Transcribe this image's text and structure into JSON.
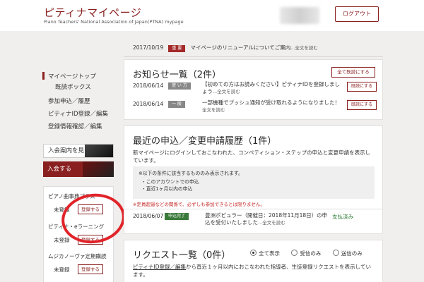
{
  "header": {
    "title": "ピティナマイページ",
    "subtitle": "Piano Teachers' National Association of Japan(PTNA) mypage",
    "logout": "ログアウト"
  },
  "sidebar": {
    "items": [
      {
        "label": "マイページトップ"
      },
      {
        "label": "既読ボックス"
      },
      {
        "label": "参加申込／履歴"
      },
      {
        "label": "ピティナID登録／編集"
      },
      {
        "label": "登録情報確認／編集"
      }
    ],
    "guide": "入会案内を見る",
    "join": "入会する",
    "subs": [
      {
        "title": "ピアノ曲事典プラス",
        "status": "未登録",
        "button": "登録する"
      },
      {
        "title": "ピティナ・eラーニング",
        "status": "未登録",
        "button": "登録する"
      },
      {
        "title": "ムジカノーヴァ定期購読",
        "status": "未登録",
        "button": "登録する"
      }
    ]
  },
  "top_notice": {
    "date": "2017/10/19",
    "badge": "重 要",
    "text": "マイページのリニューアルについてご案内",
    "more": "...全文を読む"
  },
  "news": {
    "title": "お知らせ一覧（2件）",
    "mark_all": "全て既読にする",
    "items": [
      {
        "date": "2018/06/14",
        "badge": "使 い 方",
        "text": "【初めての方はお読みください】ピティナIDを登録しましょう",
        "more": "...全文を読む",
        "button": "既読にする"
      },
      {
        "date": "2018/06/14",
        "badge": "一 般",
        "text": "一部機種でプッシュ通知が受け取れるようになりました！",
        "more": "全文を読む",
        "button": "既読にする"
      }
    ]
  },
  "applications": {
    "title": "最近の申込／変更申請履歴（1件）",
    "desc": "新マイページにログインしておこなわれた、コンペティション・ステップの申込と変更申請を表示しています。",
    "note_head": "※以下の条件に該当するもののみ表示されます。",
    "note_1": "・このアカウントでの申込",
    "note_2": "・直近1ヶ月以内の申込",
    "warn": "※定員超過などの関係で、必ずしも参加できるとは限りません。",
    "row": {
      "date": "2018/06/07",
      "badge": "申込完了",
      "text": "豊洲ポピュラー（開催日：2018年11月18日）の申込を受付いたしました",
      "more": "...全文を読む",
      "status": "支払済み"
    }
  },
  "requests": {
    "title": "リクエスト一覧（0件）",
    "radios": [
      {
        "label": "全て表示",
        "selected": true
      },
      {
        "label": "受信のみ",
        "selected": false
      },
      {
        "label": "送信のみ",
        "selected": false
      }
    ],
    "link": "ピティナID登録／編集",
    "text": "から直近１ヶ月以内におこなわれた指導者、生徒登録リクエストを表示しています。"
  },
  "colors": {
    "brand": "#8a1f1f",
    "annotation": "#e0242a",
    "paid": "#2e7d32"
  }
}
